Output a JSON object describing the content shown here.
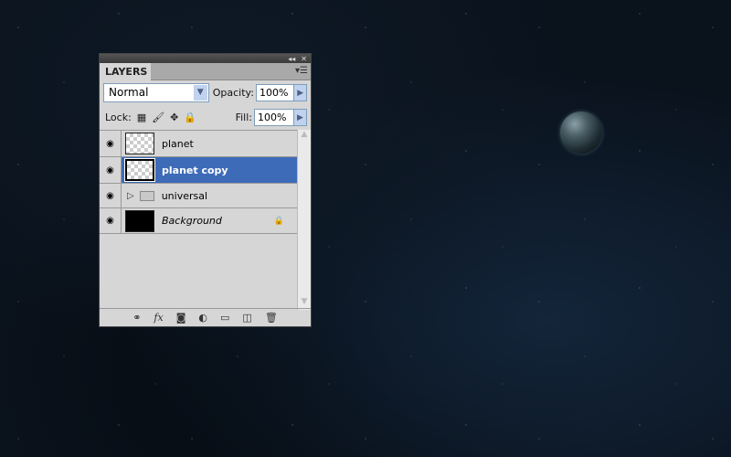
{
  "panel": {
    "title": "LAYERS",
    "blend_mode": "Normal",
    "opacity_label": "Opacity:",
    "opacity": "100%",
    "lock_label": "Lock:",
    "fill_label": "Fill:",
    "fill": "100%"
  },
  "layers": [
    {
      "name": "planet",
      "type": "layer",
      "visible": true,
      "selected": false
    },
    {
      "name": "planet copy",
      "type": "layer",
      "visible": true,
      "selected": true
    },
    {
      "name": "universal",
      "type": "group",
      "visible": true,
      "selected": false
    },
    {
      "name": "Background",
      "type": "background",
      "visible": true,
      "selected": false,
      "locked": true
    }
  ],
  "colors": {
    "selection": "#3d6bb8",
    "panel": "#d6d6d6"
  }
}
